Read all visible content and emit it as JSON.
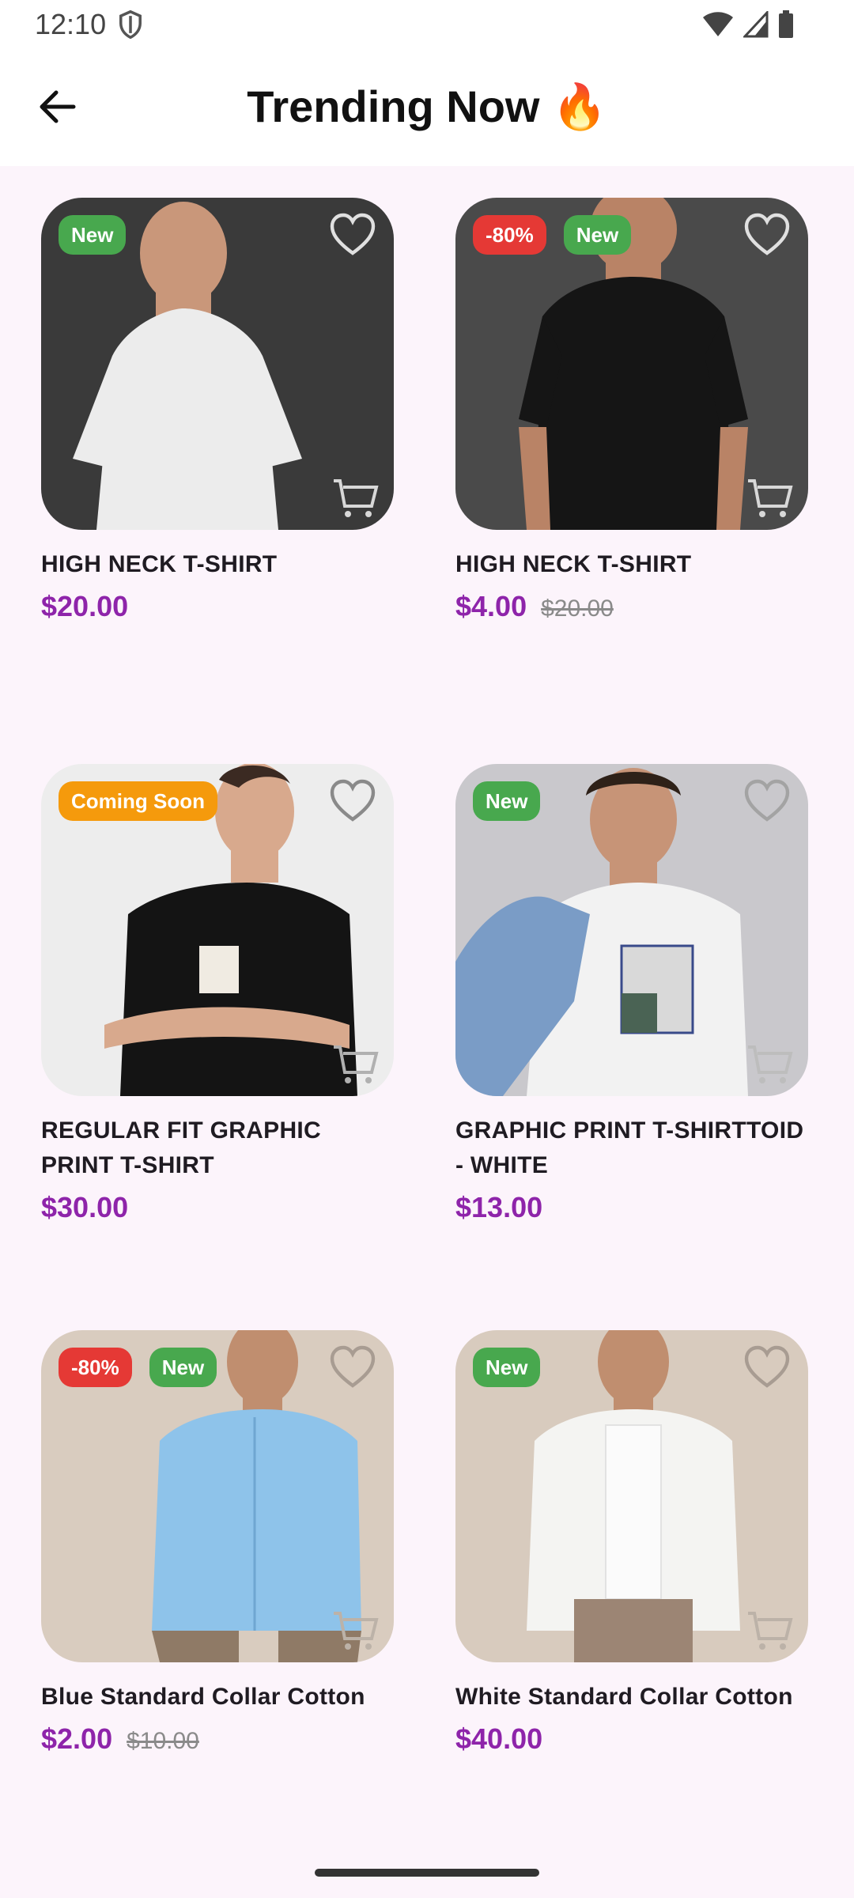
{
  "status_bar": {
    "time": "12:10"
  },
  "header": {
    "title": "Trending Now 🔥"
  },
  "products": [
    {
      "name": "HIGH NECK T-SHIRT",
      "price": "$20.00",
      "old_price": "",
      "badges": [
        {
          "text": "New",
          "kind": "new"
        }
      ]
    },
    {
      "name": "HIGH NECK T-SHIRT",
      "price": "$4.00",
      "old_price": "$20.00",
      "badges": [
        {
          "text": "-80%",
          "kind": "discount"
        },
        {
          "text": "New",
          "kind": "new"
        }
      ]
    },
    {
      "name": "REGULAR FIT GRAPHIC PRINT T-SHIRT",
      "price": "$30.00",
      "old_price": "",
      "badges": [
        {
          "text": "Coming Soon",
          "kind": "soon"
        }
      ]
    },
    {
      "name": "GRAPHIC PRINT T-SHIRTTOID - WHITE",
      "price": "$13.00",
      "old_price": "",
      "badges": [
        {
          "text": "New",
          "kind": "new"
        }
      ]
    },
    {
      "name": "Blue Standard Collar Cotton",
      "price": "$2.00",
      "old_price": "$10.00",
      "badges": [
        {
          "text": "-80%",
          "kind": "discount"
        },
        {
          "text": "New",
          "kind": "new"
        }
      ]
    },
    {
      "name": "White Standard Collar Cotton",
      "price": "$40.00",
      "old_price": "",
      "badges": [
        {
          "text": "New",
          "kind": "new"
        }
      ]
    }
  ],
  "colors": {
    "accent": "#8e24aa",
    "new_badge": "#48a84e",
    "discount_badge": "#e53935",
    "soon_badge": "#f59a0c",
    "background": "#fcf4fb"
  }
}
